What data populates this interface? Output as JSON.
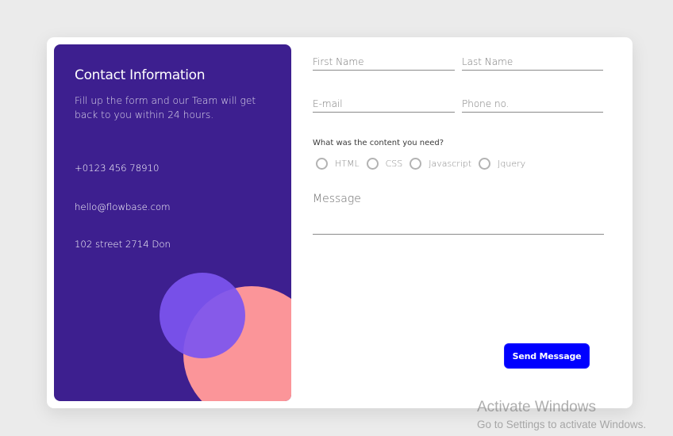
{
  "colors": {
    "panel_bg": "#3d1f8f",
    "circle_violet": "#7c55f0",
    "circle_pink": "#fb9599",
    "button_bg": "#0000ff"
  },
  "contact_info": {
    "title": "Contact Information",
    "description": "Fill up the form and our Team will get back to you within 24 hours.",
    "phone": "+0123 456 78910",
    "email": "hello@flowbase.com",
    "address": "102 street 2714 Don"
  },
  "form": {
    "first_name": {
      "placeholder": "First Name",
      "value": ""
    },
    "last_name": {
      "placeholder": "Last Name",
      "value": ""
    },
    "email": {
      "placeholder": "E-mail",
      "value": ""
    },
    "phone": {
      "placeholder": "Phone no.",
      "value": ""
    },
    "content_question": "What was the content you need?",
    "content_options": [
      {
        "label": "HTML",
        "checked": false
      },
      {
        "label": "CSS",
        "checked": false
      },
      {
        "label": "Javascript",
        "checked": false
      },
      {
        "label": "Jquery",
        "checked": false
      }
    ],
    "message": {
      "placeholder": "Message",
      "value": ""
    },
    "submit_label": "Send Message"
  },
  "os_watermark": {
    "title": "Activate Windows",
    "subtitle": "Go to Settings to activate Windows."
  }
}
